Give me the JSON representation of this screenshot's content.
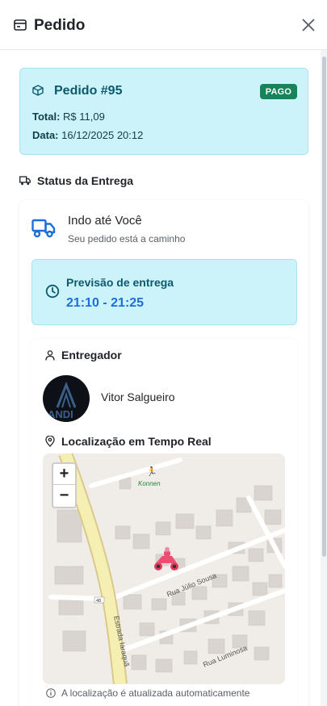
{
  "header": {
    "title": "Pedido",
    "title_icon": "receipt-icon",
    "close_icon": "close-icon"
  },
  "order": {
    "number": "Pedido #95",
    "badge": "PAGO",
    "badge_color": "#17835a",
    "total_label": "Total:",
    "total_value": "R$ 11,09",
    "date_label": "Data:",
    "date_value": "16/12/2025 20:12"
  },
  "delivery": {
    "section_title": "Status da Entrega",
    "status_title": "Indo até Você",
    "status_subtitle": "Seu pedido está a caminho",
    "eta_label": "Previsão de entrega",
    "eta_time": "21:10 - 21:25",
    "accent_color": "#1c6fd8"
  },
  "courier": {
    "section_title": "Entregador",
    "name": "Vitor Salgueiro",
    "avatar_text": "ANDI"
  },
  "tracking": {
    "section_title": "Localização em Tempo Real",
    "zoom_in": "+",
    "zoom_out": "−",
    "map_labels": {
      "poi": "Konnen",
      "street1": "Rua Júlio Sousa",
      "street2": "Estrada Iaraquã",
      "street3": "Rua Luminosa",
      "shield": "48"
    },
    "note": "A localização é atualizada automaticamente"
  }
}
